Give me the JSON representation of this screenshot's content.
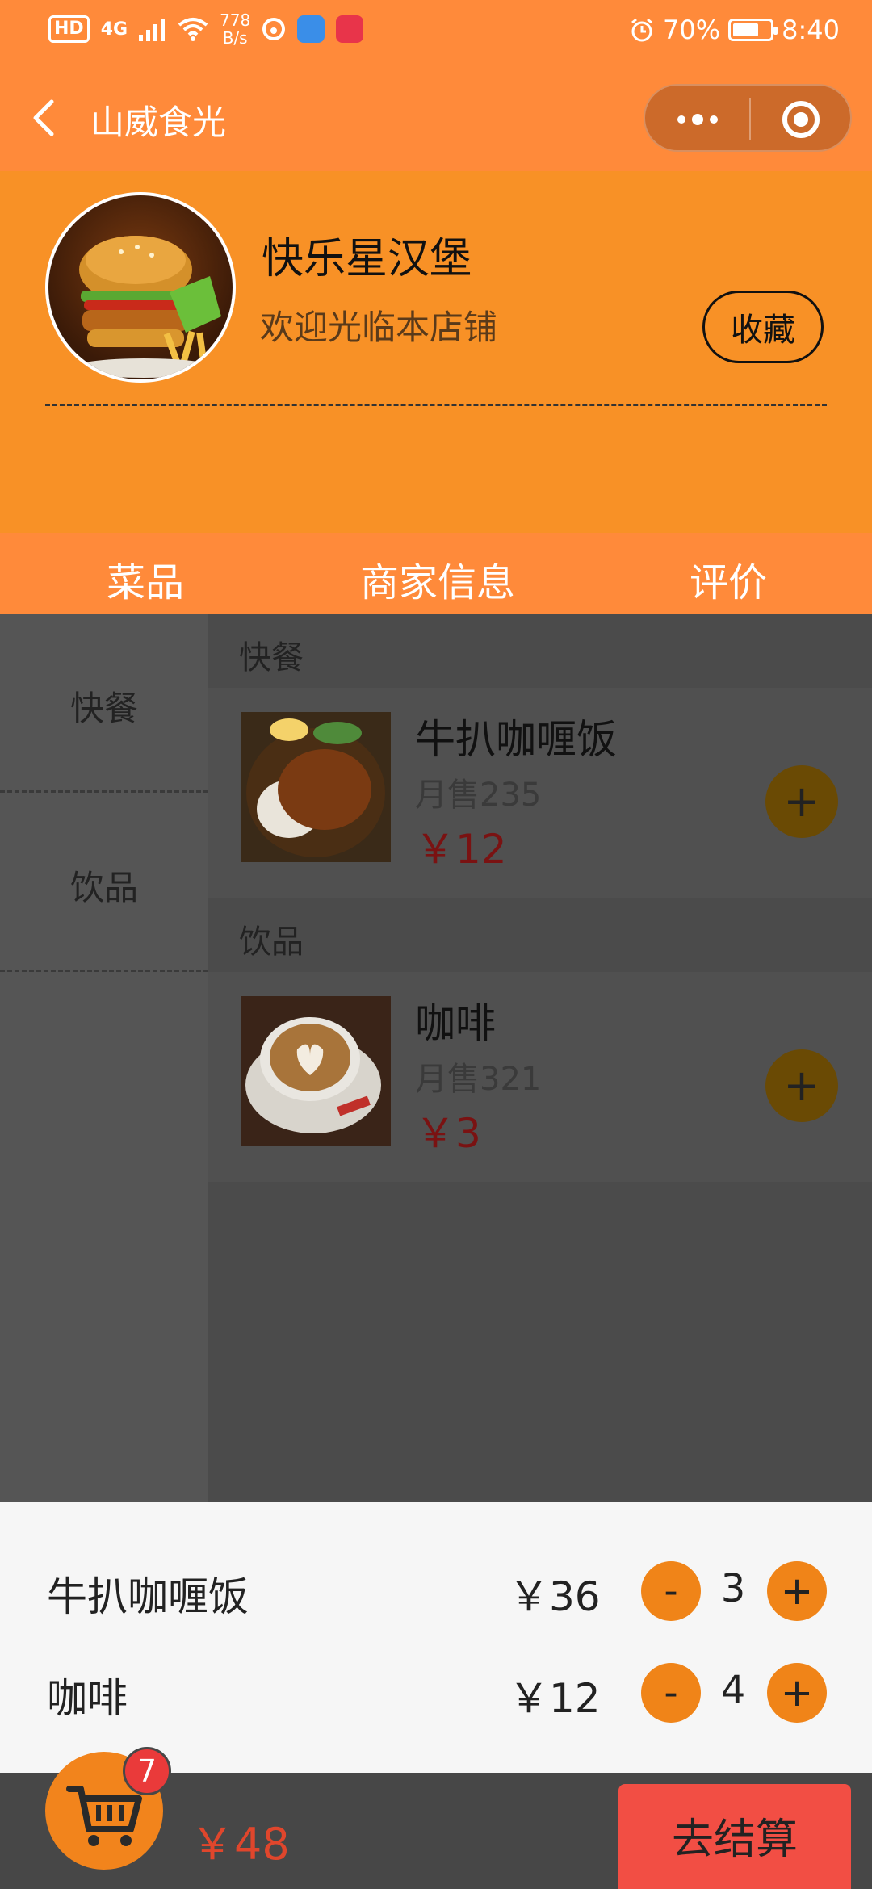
{
  "status_bar": {
    "hd": "HD",
    "signal": "4G",
    "speed_value": "778",
    "speed_unit": "B/s",
    "battery_percent": "70%",
    "battery_level": 0.7,
    "time": "8:40"
  },
  "nav": {
    "title": "山威食光"
  },
  "shop": {
    "name": "快乐星汉堡",
    "subtitle": "欢迎光临本店铺",
    "favorite_label": "收藏"
  },
  "tabs": [
    {
      "label": "菜品"
    },
    {
      "label": "商家信息"
    },
    {
      "label": "评价"
    }
  ],
  "categories": [
    {
      "label": "快餐"
    },
    {
      "label": "饮品"
    }
  ],
  "sections": [
    {
      "label": "快餐",
      "items": [
        {
          "name": "牛扒咖喱饭",
          "sold": "月售235",
          "price": "￥12",
          "add_label": "+"
        }
      ]
    },
    {
      "label": "饮品",
      "items": [
        {
          "name": "咖啡",
          "sold": "月售321",
          "price": "￥3",
          "add_label": "+"
        }
      ]
    }
  ],
  "cart": {
    "rows": [
      {
        "name": "牛扒咖喱饭",
        "price": "￥36",
        "minus": "-",
        "qty": "3",
        "plus": "+"
      },
      {
        "name": "咖啡",
        "price": "￥12",
        "minus": "-",
        "qty": "4",
        "plus": "+"
      }
    ],
    "badge_count": "7",
    "total": "￥48",
    "checkout_label": "去结算"
  },
  "colors": {
    "orange": "#ff8a3a",
    "shop_bg": "#f89126",
    "checkout": "#f24e44",
    "price_red": "#e0462c"
  }
}
